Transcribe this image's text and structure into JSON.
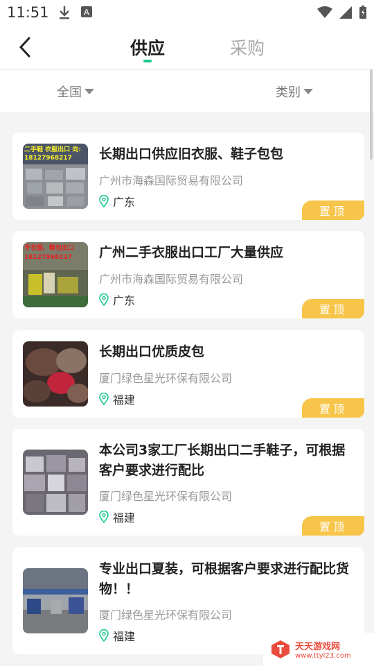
{
  "status_bar": {
    "time": "11:51"
  },
  "header": {
    "tabs": [
      {
        "label": "供应",
        "active": true
      },
      {
        "label": "采购",
        "active": false
      }
    ],
    "accent_color": "#18c88c"
  },
  "filters": {
    "region": "全国",
    "category": "类别"
  },
  "listings": [
    {
      "title": "长期出口供应旧衣服、鞋子包包",
      "company": "广州市海森国际贸易有限公司",
      "location": "广东",
      "badge": "置顶",
      "thumb_caption": "二手鞋 衣服出口 向: 18127968217"
    },
    {
      "title": "广州二手衣服出口工厂大量供应",
      "company": "广州市海森国际贸易有限公司",
      "location": "广东",
      "badge": "置顶",
      "thumb_caption": "手衣服、鞋包出口 18127968217"
    },
    {
      "title": "长期出口优质皮包",
      "company": "厦门绿色星光环保有限公司",
      "location": "福建",
      "badge": "置顶"
    },
    {
      "title": "本公司3家工厂长期出口二手鞋子，可根据客户要求进行配比",
      "company": "厦门绿色星光环保有限公司",
      "location": "福建",
      "badge": "置顶"
    },
    {
      "title": "专业出口夏装，可根据客户要求进行配比货物！！",
      "company": "厦门绿色星光环保有限公司",
      "location": "福建"
    }
  ],
  "watermark": {
    "name": "天天游戏网",
    "url": "www.ttyl23.com"
  },
  "colors": {
    "badge": "#f7c54a",
    "accent": "#18c88c"
  }
}
